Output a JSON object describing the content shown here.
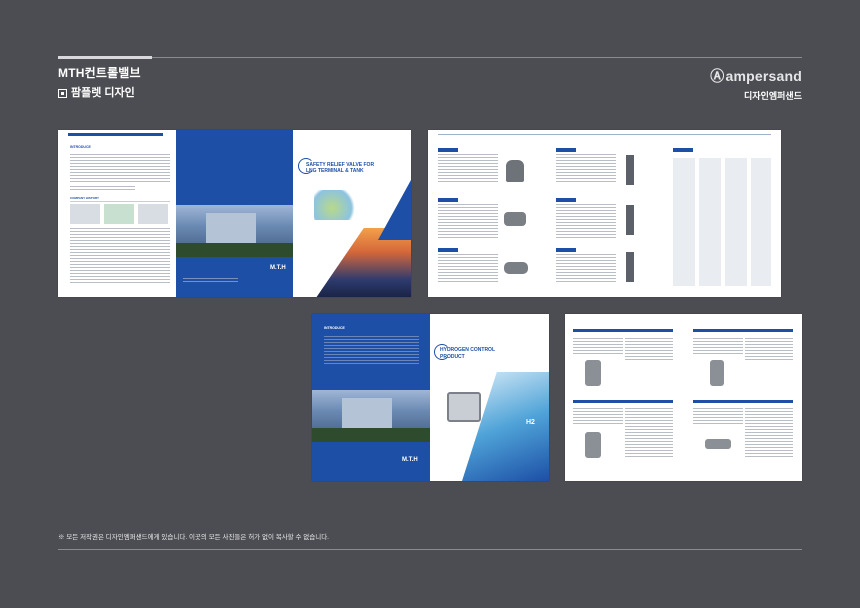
{
  "header": {
    "title": "MTH컨트롤밸브",
    "subtitle": "팜플렛 디자인"
  },
  "brand": {
    "logo_text": "ampersand",
    "sub_text": "디자인엠퍼샌드"
  },
  "footer": {
    "copyright": "※ 모든 저작권은 디자인엠퍼샌드에게 있습니다. 이곳의 모든 사진들은 허가 없이 복사할 수 없습니다."
  },
  "spreads": {
    "lng": {
      "intro_heading": "INTRODUCE",
      "cover_title_1": "SAFETY RELIEF VALVE FOR",
      "cover_title_2": "LNG TERMINAL & TANK",
      "logo": "M.T.H",
      "section_heading": "COMPANY HISTORY"
    },
    "hydrogen": {
      "intro_heading": "INTRODUCE",
      "cover_title_1": "HYDROGEN CONTROL",
      "cover_title_2": "PRODUCT",
      "logo": "M.T.H",
      "badge": "H2"
    }
  },
  "colors": {
    "background": "#4c4d52",
    "brand_blue": "#1d4fa6",
    "accent_orange": "#e9812f"
  }
}
